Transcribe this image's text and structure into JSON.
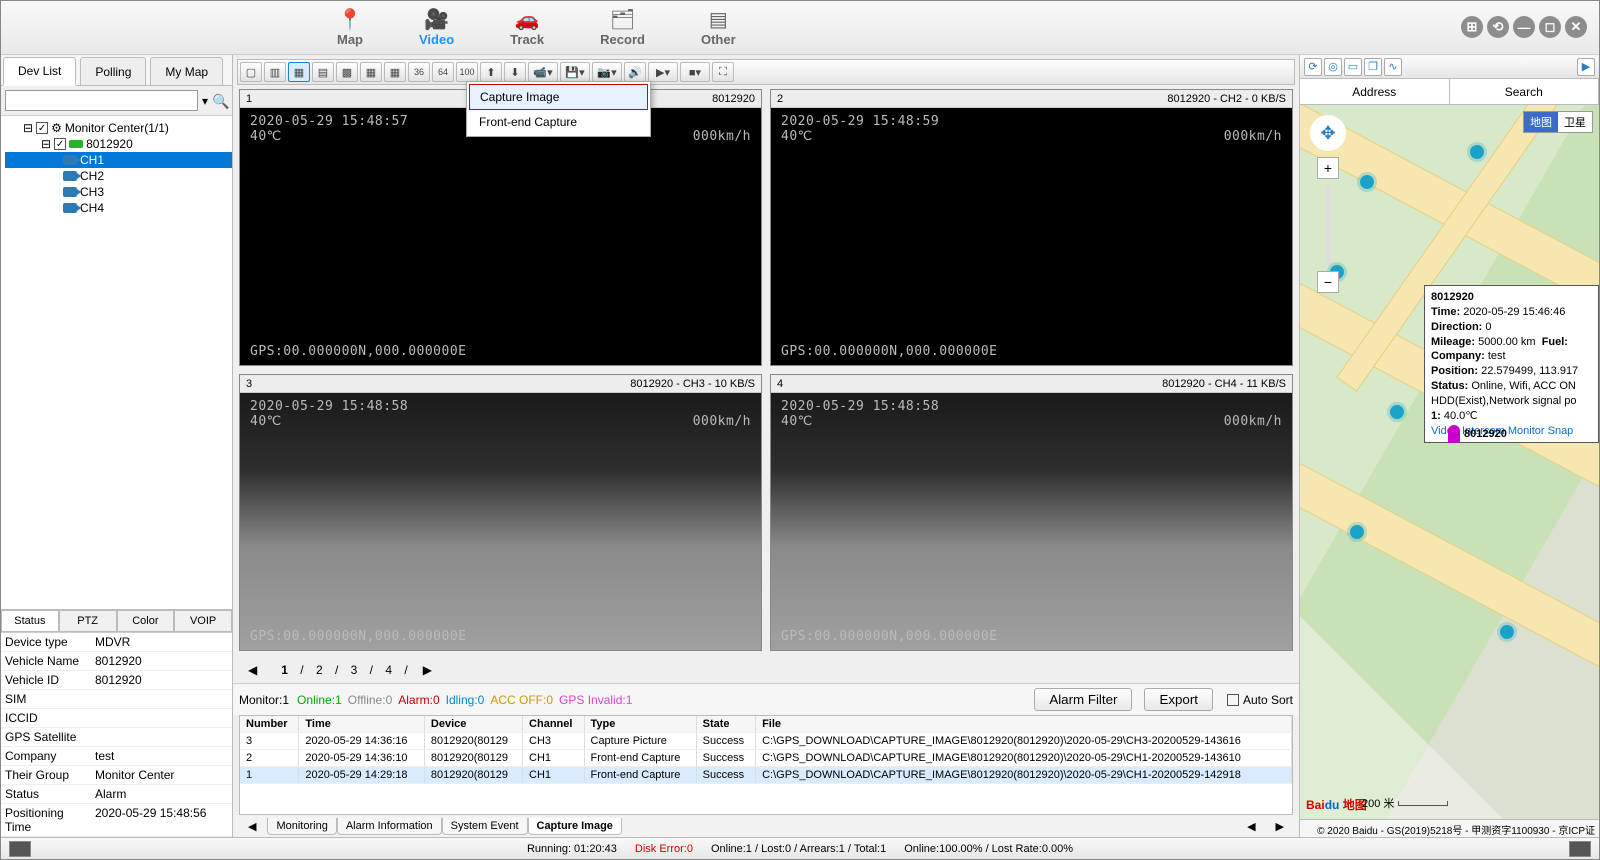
{
  "topnav": [
    "Map",
    "Video",
    "Track",
    "Record",
    "Other"
  ],
  "topnav_active": 1,
  "left_tabs": [
    "Dev List",
    "Polling",
    "My Map"
  ],
  "tree": {
    "root": "Monitor Center(1/1)",
    "device": "8012920",
    "channels": [
      "CH1",
      "CH2",
      "CH3",
      "CH4"
    ],
    "selected": "CH1"
  },
  "sub_tabs": [
    "Status",
    "PTZ",
    "Color",
    "VOIP"
  ],
  "props": [
    [
      "Device type",
      "MDVR"
    ],
    [
      "Vehicle Name",
      "8012920"
    ],
    [
      "Vehicle ID",
      "8012920"
    ],
    [
      "SIM",
      ""
    ],
    [
      "ICCID",
      ""
    ],
    [
      "GPS Satellite",
      ""
    ],
    [
      "Company",
      "test"
    ],
    [
      "Their Group",
      "Monitor Center"
    ],
    [
      "Status",
      "Alarm"
    ],
    [
      "Positioning Time",
      "2020-05-29 15:48:56"
    ]
  ],
  "ctx_menu": [
    "Capture Image",
    "Front-end Capture"
  ],
  "cells": [
    {
      "n": "1",
      "title": "8012920",
      "ts": "2020-05-29 15:48:57",
      "temp": "40℃",
      "spd": "000km/h",
      "gps": "GPS:00.000000N,000.000000E",
      "kind": "blk"
    },
    {
      "n": "2",
      "title": "8012920 - CH2 - 0 KB/S",
      "ts": "2020-05-29 15:48:59",
      "temp": "40℃",
      "spd": "000km/h",
      "gps": "GPS:00.000000N,000.000000E",
      "kind": "blk"
    },
    {
      "n": "3",
      "title": "8012920 - CH3 - 10 KB/S",
      "ts": "2020-05-29 15:48:58",
      "temp": "40℃",
      "spd": "000km/h",
      "gps": "GPS:00.000000N,000.000000E",
      "kind": "live"
    },
    {
      "n": "4",
      "title": "8012920 - CH4 - 11 KB/S",
      "ts": "2020-05-29 15:48:58",
      "temp": "40℃",
      "spd": "000km/h",
      "gps": "GPS:00.000000N,000.000000E",
      "kind": "live"
    }
  ],
  "pages": [
    "1",
    "2",
    "3",
    "4"
  ],
  "monline": {
    "Monitor": "1",
    "Online": "1",
    "Offline": "0",
    "Alarm": "0",
    "Idling": "0",
    "ACC OFF": "0",
    "GPS Invalid": "1"
  },
  "monbtn": {
    "filter": "Alarm Filter",
    "export": "Export",
    "autosort": "Auto Sort"
  },
  "table_cols": [
    "Number",
    "Time",
    "Device",
    "Channel",
    "Type",
    "State",
    "File"
  ],
  "table_rows": [
    [
      "3",
      "2020-05-29 14:36:16",
      "8012920(80129",
      "CH3",
      "Capture Picture",
      "Success",
      "C:\\GPS_DOWNLOAD\\CAPTURE_IMAGE\\8012920(8012920)\\2020-05-29\\CH3-20200529-143616"
    ],
    [
      "2",
      "2020-05-29 14:36:10",
      "8012920(80129",
      "CH1",
      "Front-end Capture",
      "Success",
      "C:\\GPS_DOWNLOAD\\CAPTURE_IMAGE\\8012920(8012920)\\2020-05-29\\CH1-20200529-143610"
    ],
    [
      "1",
      "2020-05-29 14:29:18",
      "8012920(80129",
      "CH1",
      "Front-end Capture",
      "Success",
      "C:\\GPS_DOWNLOAD\\CAPTURE_IMAGE\\8012920(8012920)\\2020-05-29\\CH1-20200529-142918"
    ]
  ],
  "bottom_tabs": [
    "Monitoring",
    "Alarm Information",
    "System Event",
    "Capture Image"
  ],
  "bottom_active": 3,
  "addrbar": {
    "addr": "Address",
    "search": "Search"
  },
  "maptypes": [
    "地图",
    "卫星"
  ],
  "tooltip": {
    "id": "8012920",
    "time_l": "Time:",
    "time_v": " 2020-05-29 15:46:46",
    "dir_l": "Direction:",
    "dir_v": " 0",
    "mil_l": "Mileage:",
    "mil_v": " 5000.00 km",
    "fuel_l": "Fuel:",
    "com_l": "Company:",
    "com_v": " test",
    "pos_l": "Position:",
    "pos_v": " 22.579499, 113.917",
    "sta_l": "Status:",
    "sta_v": " Online, Wifi, ACC ON",
    "hdd": "HDD(Exist),Network signal po",
    "temp_l": "1:",
    "temp_v": " 40.0℃",
    "links": [
      "Video",
      "Intercom",
      "Monitor",
      "Snap"
    ]
  },
  "veh_label": "8012920",
  "mapscale": "200 米",
  "baidu": "Baidu 地图",
  "mapfoot": "© 2020 Baidu - GS(2019)5218号 - 甲测资字1100930 - 京ICP证",
  "status": {
    "running": "Running: 01:20:43",
    "disk": "Disk Error:0",
    "online": "Online:1 / Lost:0 / Arrears:1 / Total:1",
    "rate": "Online:100.00% / Lost Rate:0.00%"
  }
}
